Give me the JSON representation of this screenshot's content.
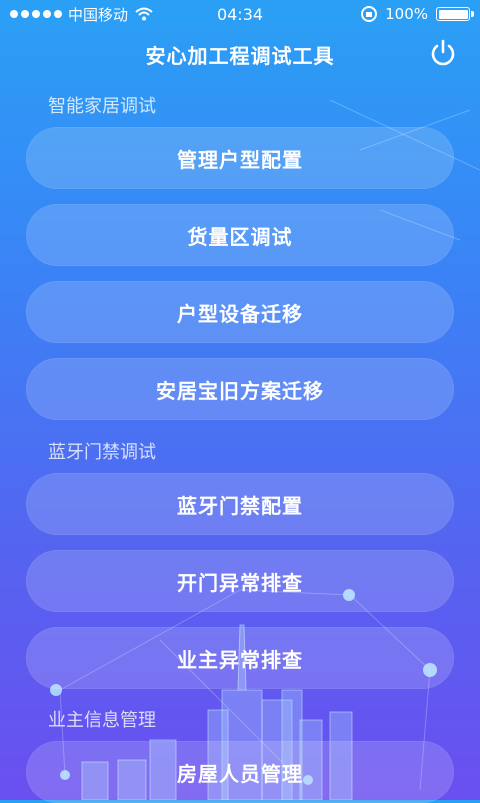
{
  "status_bar": {
    "carrier": "中国移动",
    "time": "04:34",
    "battery": "100%"
  },
  "header": {
    "title": "安心加工程调试工具"
  },
  "sections": [
    {
      "label": "智能家居调试",
      "items": [
        "管理户型配置",
        "货量区调试",
        "户型设备迁移",
        "安居宝旧方案迁移"
      ]
    },
    {
      "label": "蓝牙门禁调试",
      "items": [
        "蓝牙门禁配置",
        "开门异常排查",
        "业主异常排查"
      ]
    },
    {
      "label": "业主信息管理",
      "items": [
        "房屋人员管理"
      ]
    }
  ]
}
